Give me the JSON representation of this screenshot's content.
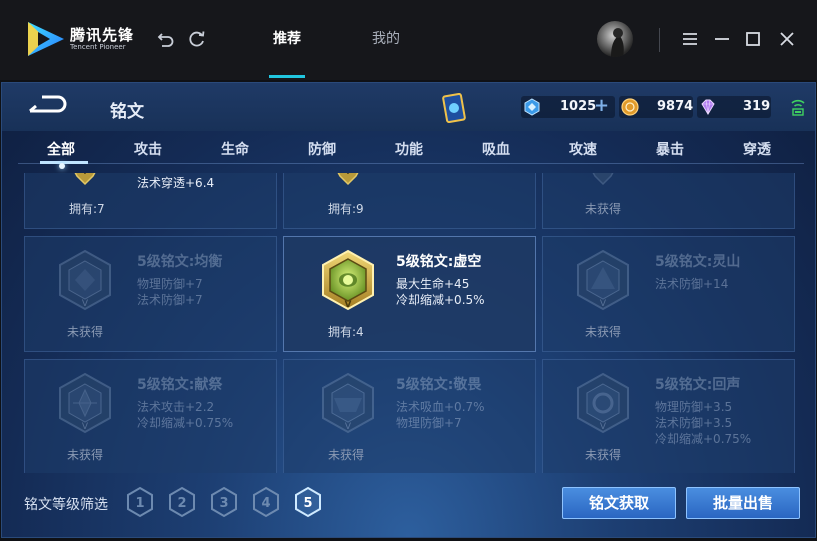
{
  "app": {
    "logo_cn": "腾讯先锋",
    "logo_en": "Tencent Pioneer",
    "tabs": [
      {
        "label": "推荐",
        "active": true
      },
      {
        "label": "我的",
        "active": false
      }
    ],
    "accent": "#21c6e0"
  },
  "game": {
    "title": "铭文",
    "currencies": [
      {
        "icon": "diamond-icon",
        "value": "1025"
      },
      {
        "icon": "gold-coin-icon",
        "value": "9874"
      },
      {
        "icon": "gem-icon",
        "value": "319"
      }
    ],
    "categories": [
      "全部",
      "攻击",
      "生命",
      "防御",
      "功能",
      "吸血",
      "攻速",
      "暴击",
      "穿透"
    ],
    "active_category": "全部",
    "top_row": [
      {
        "partial_text": "法术穿透+6.4",
        "status": "拥有:7"
      },
      {
        "status": "拥有:9"
      },
      {
        "status": "未获得"
      }
    ],
    "row2": [
      {
        "name": "5级铭文:均衡",
        "attrs": [
          "物理防御+7",
          "法术防御+7"
        ],
        "status": "未获得",
        "owned": false
      },
      {
        "name": "5级铭文:虚空",
        "attrs": [
          "最大生命+45",
          "冷却缩减+0.5%"
        ],
        "status": "拥有:4",
        "owned": true
      },
      {
        "name": "5级铭文:灵山",
        "attrs": [
          "法术防御+14"
        ],
        "status": "未获得",
        "owned": false
      }
    ],
    "row3": [
      {
        "name": "5级铭文:献祭",
        "attrs": [
          "法术攻击+2.2",
          "冷却缩减+0.75%"
        ],
        "status": "未获得",
        "owned": false
      },
      {
        "name": "5级铭文:敬畏",
        "attrs": [
          "法术吸血+0.7%",
          "物理防御+7"
        ],
        "status": "未获得",
        "owned": false
      },
      {
        "name": "5级铭文:回声",
        "attrs": [
          "物理防御+3.5",
          "法术防御+3.5",
          "冷却缩减+0.75%"
        ],
        "status": "未获得",
        "owned": false
      }
    ],
    "filter_label": "铭文等级筛选",
    "levels": [
      "1",
      "2",
      "3",
      "4",
      "5"
    ],
    "selected_level": "5",
    "buttons": {
      "acquire": "铭文获取",
      "sell": "批量出售"
    }
  }
}
